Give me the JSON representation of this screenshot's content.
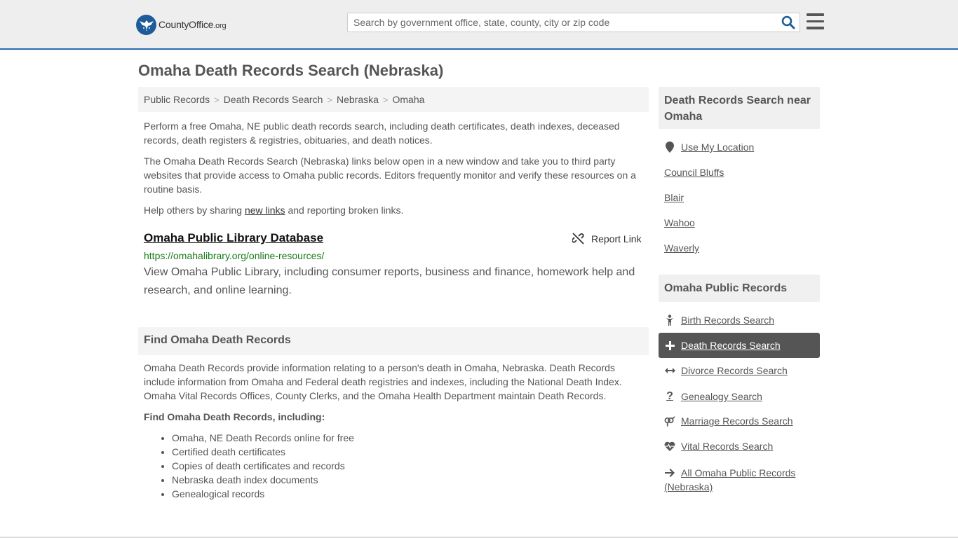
{
  "header": {
    "logo_text": "CountyOffice",
    "logo_suffix": ".org",
    "search_placeholder": "Search by government office, state, county, city or zip code"
  },
  "page": {
    "title": "Omaha Death Records Search (Nebraska)"
  },
  "breadcrumb": [
    "Public Records",
    "Death Records Search",
    "Nebraska",
    "Omaha"
  ],
  "intro": {
    "p1": "Perform a free Omaha, NE public death records search, including death certificates, death indexes, deceased records, death registers & registries, obituaries, and death notices.",
    "p2": "The Omaha Death Records Search (Nebraska) links below open in a new window and take you to third party websites that provide access to Omaha public records. Editors frequently monitor and verify these resources on a routine basis.",
    "p3_prefix": "Help others by sharing ",
    "p3_link": "new links",
    "p3_suffix": " and reporting broken links."
  },
  "result": {
    "title": "Omaha Public Library Database",
    "report_label": "Report Link",
    "url": "https://omahalibrary.org/online-resources/",
    "description": "View Omaha Public Library, including consumer reports, business and finance, homework help and research, and online learning."
  },
  "find_section": {
    "heading": "Find Omaha Death Records",
    "body": "Omaha Death Records provide information relating to a person's death in Omaha, Nebraska. Death Records include information from Omaha and Federal death registries and indexes, including the National Death Index. Omaha Vital Records Offices, County Clerks, and the Omaha Health Department maintain Death Records.",
    "subheading": "Find Omaha Death Records, including:",
    "items": [
      "Omaha, NE Death Records online for free",
      "Certified death certificates",
      "Copies of death certificates and records",
      "Nebraska death index documents",
      "Genealogical records"
    ]
  },
  "sidebar": {
    "nearby_heading": "Death Records Search near Omaha",
    "use_location": "Use My Location",
    "nearby": [
      "Council Bluffs",
      "Blair",
      "Wahoo",
      "Waverly"
    ],
    "public_heading": "Omaha Public Records",
    "records": [
      {
        "label": "Birth Records Search",
        "icon": "child-icon"
      },
      {
        "label": "Death Records Search",
        "icon": "plus-icon"
      },
      {
        "label": "Divorce Records Search",
        "icon": "arrows-h-icon"
      },
      {
        "label": "Genealogy Search",
        "icon": "question-icon"
      },
      {
        "label": "Marriage Records Search",
        "icon": "venus-mars-icon"
      },
      {
        "label": "Vital Records Search",
        "icon": "heartbeat-icon"
      },
      {
        "label": "All Omaha Public Records",
        "icon": "arrow-right-icon"
      }
    ],
    "all_records_suffix": "(Nebraska)"
  },
  "colors": {
    "header_bg": "#eeeeee",
    "header_border": "#2a69ac",
    "link_green": "#1a7a1a",
    "active_bg": "#555555"
  }
}
